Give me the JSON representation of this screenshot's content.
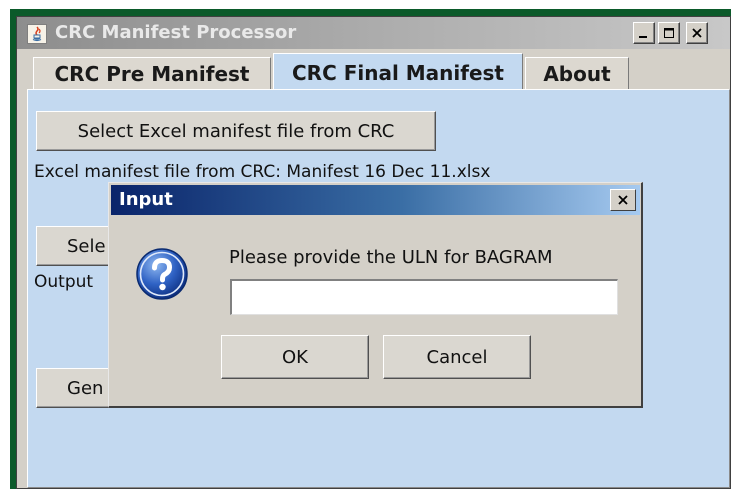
{
  "window": {
    "title": "CRC Manifest Processor"
  },
  "tabs": [
    {
      "label": "CRC Pre Manifest",
      "selected": false
    },
    {
      "label": "CRC Final Manifest",
      "selected": true
    },
    {
      "label": "About",
      "selected": false
    }
  ],
  "panel": {
    "select_excel_label": "Select Excel manifest file from CRC",
    "excel_file_text": "Excel manifest file from CRC:  Manifest 16 Dec 11.xlsx",
    "select_output_label_visible": "Sele",
    "output_label_visible": "Output",
    "generate_label_visible": "Gen"
  },
  "dialog": {
    "title": "Input",
    "message": "Please provide the ULN for BAGRAM",
    "input_value": "",
    "ok_label": "OK",
    "cancel_label": "Cancel",
    "icon": "question-icon"
  },
  "colors": {
    "frame_green": "#0b5a2a",
    "panel_blue": "#c3d9f0",
    "dialog_title_start": "#0a246a",
    "dialog_title_end": "#a6caf0",
    "window_gray": "#d4d0c8"
  }
}
